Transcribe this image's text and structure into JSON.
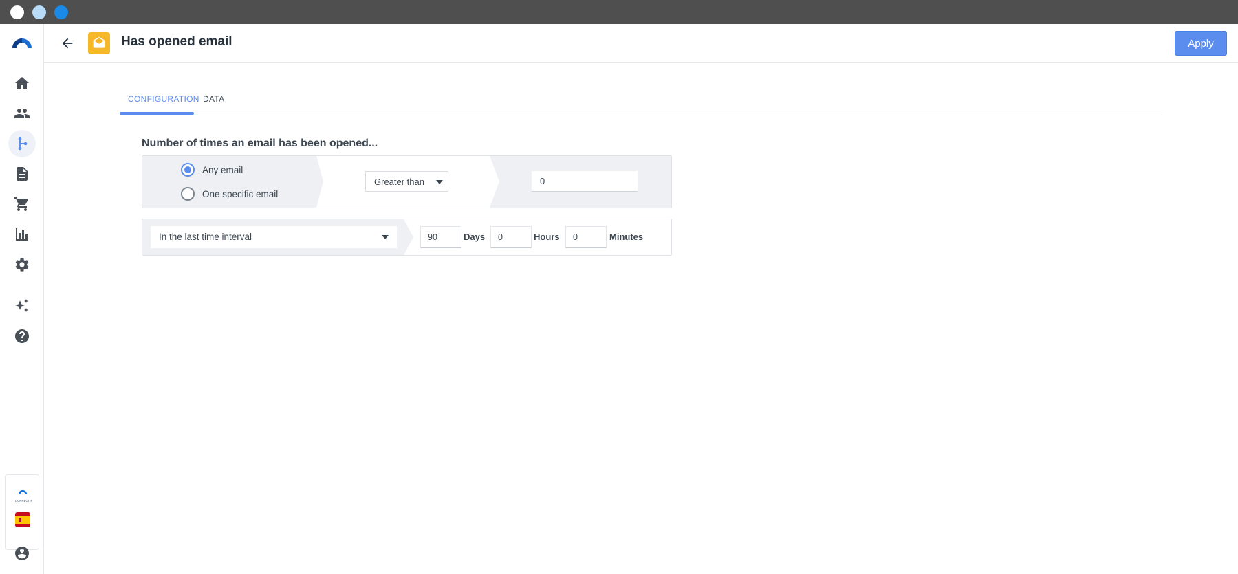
{
  "header": {
    "title": "Has opened email",
    "apply_label": "Apply"
  },
  "sidebar": {
    "items": [
      {
        "name": "home-icon"
      },
      {
        "name": "contacts-icon"
      },
      {
        "name": "workflow-icon",
        "active": true
      },
      {
        "name": "document-icon"
      },
      {
        "name": "cart-icon"
      },
      {
        "name": "analytics-icon"
      },
      {
        "name": "settings-icon"
      },
      {
        "name": "sparkle-icon"
      },
      {
        "name": "help-icon"
      }
    ],
    "account_logo_text": "CONNECTIF"
  },
  "tabs": [
    {
      "label": "CONFIGURATION",
      "active": true
    },
    {
      "label": "DATA",
      "active": false
    }
  ],
  "config": {
    "section_title": "Number of times an email has been opened...",
    "radio_options": [
      {
        "label": "Any email",
        "selected": true
      },
      {
        "label": "One specific email",
        "selected": false
      }
    ],
    "comparison": "Greater than",
    "count_value": "0",
    "interval": "In the last time interval",
    "days_value": "90",
    "days_label": "Days",
    "hours_value": "0",
    "hours_label": "Hours",
    "minutes_value": "0",
    "minutes_label": "Minutes"
  },
  "colors": {
    "accent": "#5b8def",
    "email_badge": "#f6b829",
    "sidebar_icon": "#4a5058"
  }
}
